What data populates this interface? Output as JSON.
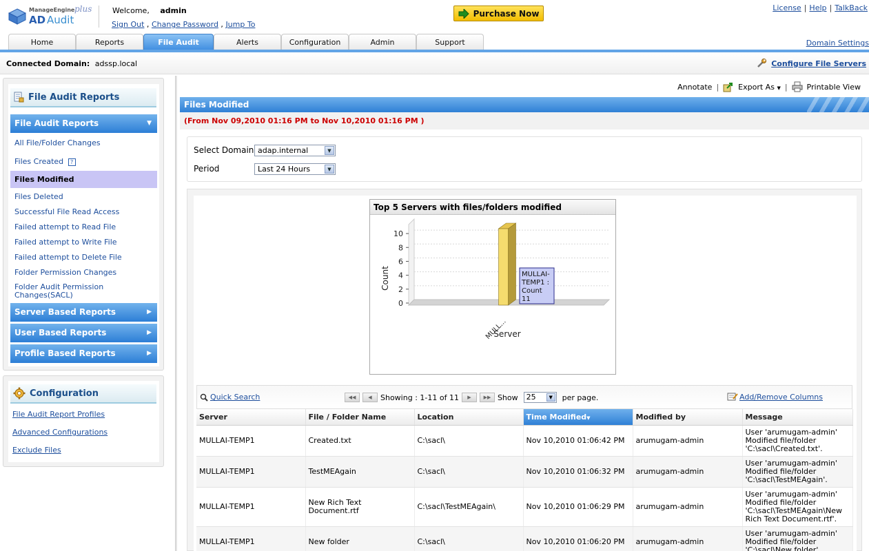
{
  "header": {
    "logo": {
      "brand": "ManageEngine",
      "plus": "plus",
      "product_ad": "AD",
      "product_audit": "Audit"
    },
    "welcome_label": "Welcome,",
    "username": "admin",
    "user_links": [
      "Sign Out",
      "Change Password",
      "Jump To"
    ],
    "purchase_label": "Purchase Now",
    "top_links": [
      "License",
      "Help",
      "TalkBack"
    ],
    "domain_settings": "Domain Settings"
  },
  "tabs": [
    {
      "label": "Home",
      "active": false
    },
    {
      "label": "Reports",
      "active": false
    },
    {
      "label": "File Audit",
      "active": true
    },
    {
      "label": "Alerts",
      "active": false
    },
    {
      "label": "Configuration",
      "active": false
    },
    {
      "label": "Admin",
      "active": false
    },
    {
      "label": "Support",
      "active": false
    }
  ],
  "connection": {
    "label": "Connected Domain:",
    "domain": "adssp.local",
    "configure_link": "Configure File Servers"
  },
  "sidebar": {
    "title": "File Audit Reports",
    "sections": {
      "file_audit": "File Audit Reports",
      "server": "Server Based Reports",
      "user": "User Based Reports",
      "profile": "Profile Based Reports"
    },
    "items": [
      "All File/Folder Changes",
      "Files Created",
      "Files Modified",
      "Files Deleted",
      "Successful File Read Access",
      "Failed attempt to Read File",
      "Failed attempt to Write File",
      "Failed attempt to Delete File",
      "Folder Permission Changes",
      "Folder Audit Permission Changes(SACL)"
    ],
    "selected_item": "Files Modified",
    "help_badge": "?"
  },
  "config_panel": {
    "title": "Configuration",
    "links": [
      "File Audit Report Profiles",
      "Advanced Configurations",
      "Exclude Files"
    ]
  },
  "toolbar": {
    "annotate": "Annotate",
    "export": "Export As",
    "printable": "Printable View"
  },
  "report": {
    "title": "Files Modified",
    "date_range": "(From Nov 09,2010 01:16 PM to Nov 10,2010 01:16 PM )"
  },
  "filters": {
    "domain_label": "Select Domain",
    "domain_value": "adap.internal",
    "period_label": "Period",
    "period_value": "Last 24 Hours"
  },
  "chart_data": {
    "type": "bar",
    "title": "Top 5 Servers with files/folders modified",
    "xlabel": "Server",
    "ylabel": "Count",
    "categories": [
      "MULL..."
    ],
    "values": [
      11
    ],
    "ylim": [
      0,
      11
    ],
    "yticks": [
      0,
      2,
      4,
      6,
      8,
      10
    ],
    "grid": true,
    "bar_color": "#f5dc6e",
    "tooltip": {
      "lines": [
        "MULLAI-",
        "TEMP1 :",
        "Count",
        "11"
      ]
    }
  },
  "grid": {
    "quick_search": "Quick Search",
    "showing": "Showing : 1-11 of 11",
    "show_label": "Show",
    "page_size": "25",
    "per_page": "per page.",
    "add_remove": "Add/Remove Columns",
    "columns": [
      "Server",
      "File / Folder Name",
      "Location",
      "Time Modified",
      "Modified by",
      "Message"
    ],
    "sorted_column": "Time Modified",
    "rows": [
      [
        "MULLAI-TEMP1",
        "Created.txt",
        "C:\\sacl\\",
        "Nov 10,2010 01:06:42 PM",
        "arumugam-admin",
        "User 'arumugam-admin' Modified file/folder 'C:\\sacl\\Created.txt'."
      ],
      [
        "MULLAI-TEMP1",
        "TestMEAgain",
        "C:\\sacl\\",
        "Nov 10,2010 01:06:32 PM",
        "arumugam-admin",
        "User 'arumugam-admin' Modified file/folder 'C:\\sacl\\TestMEAgain'."
      ],
      [
        "MULLAI-TEMP1",
        "New Rich Text Document.rtf",
        "C:\\sacl\\TestMEAgain\\",
        "Nov 10,2010 01:06:29 PM",
        "arumugam-admin",
        "User 'arumugam-admin' Modified file/folder 'C:\\sacl\\TestMEAgain\\New Rich Text Document.rtf'."
      ],
      [
        "MULLAI-TEMP1",
        "New folder",
        "C:\\sacl\\",
        "Nov 10,2010 01:06:20 PM",
        "arumugam-admin",
        "User 'arumugam-admin' Modified file/folder 'C:\\sacl\\New folder'."
      ]
    ]
  }
}
